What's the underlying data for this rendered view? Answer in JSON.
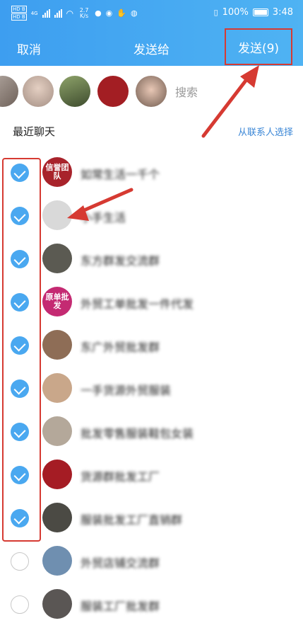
{
  "status_bar": {
    "left_label": "4G",
    "speed": "2.7 K/s",
    "battery": "100%",
    "time": "3:48"
  },
  "header": {
    "cancel": "取消",
    "title": "发送给",
    "send": "发送(9)"
  },
  "search": {
    "placeholder": "搜索"
  },
  "section": {
    "title": "最近聊天",
    "contact_link": "从联系人选择"
  },
  "list": [
    {
      "name": "如常生活一千个",
      "checked": true,
      "avatar_text": "信誉团队",
      "avatar_color": "#a8232b"
    },
    {
      "name": "小手生活",
      "checked": true,
      "avatar_text": "",
      "avatar_color": "#d9d9d9"
    },
    {
      "name": "东方群发交流群",
      "checked": true,
      "avatar_text": "",
      "avatar_color": "#5b5a52"
    },
    {
      "name": "外贸工单批发一件代发",
      "checked": true,
      "avatar_text": "原单批发",
      "avatar_color": "#c42a72"
    },
    {
      "name": "东广外贸批发群",
      "checked": true,
      "avatar_text": "",
      "avatar_color": "#8e6d56"
    },
    {
      "name": "一手货源外贸服装",
      "checked": true,
      "avatar_text": "",
      "avatar_color": "#c9a78a"
    },
    {
      "name": "批发零售服装鞋包女装",
      "checked": true,
      "avatar_text": "",
      "avatar_color": "#b4a89a"
    },
    {
      "name": "货源群批发工厂",
      "checked": true,
      "avatar_text": "",
      "avatar_color": "#a51c24"
    },
    {
      "name": "服装批发工厂直销群",
      "checked": true,
      "avatar_text": "",
      "avatar_color": "#4b4a44"
    },
    {
      "name": "外贸店铺交流群",
      "checked": false,
      "avatar_text": "",
      "avatar_color": "#6f8fb0"
    },
    {
      "name": "服装工厂批发群",
      "checked": false,
      "avatar_text": "",
      "avatar_color": "#5a5654"
    }
  ],
  "colors": {
    "header_start": "#3d9ef0",
    "header_end": "#4fb3f3",
    "check": "#4aa8f0",
    "annotation": "#d63a32",
    "link": "#3a86d6"
  }
}
